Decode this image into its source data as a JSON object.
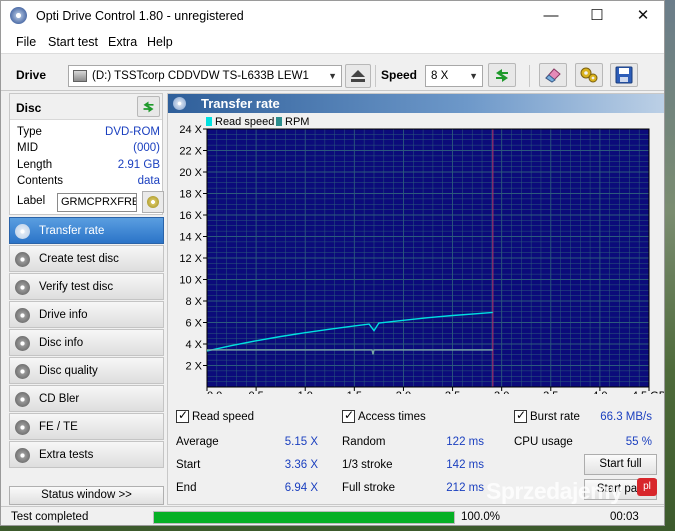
{
  "window": {
    "title": "Opti Drive Control 1.80 - unregistered",
    "minimize": "—",
    "maximize": "☐",
    "close": "✕"
  },
  "menu": [
    "File",
    "Start test",
    "Extra",
    "Help"
  ],
  "toolbar": {
    "drive_label": "Drive",
    "drive_value": "(D:)   TSSTcorp CDDVDW TS-L633B LEW1",
    "speed_label": "Speed",
    "speed_value": "8 X",
    "icons": [
      "eject-icon",
      "refresh-icon",
      "eraser-icon",
      "gears-icon",
      "save-icon"
    ]
  },
  "disc": {
    "header": "Disc",
    "rows": [
      {
        "key": "Type",
        "value": "DVD-ROM"
      },
      {
        "key": "MID",
        "value": "(000)"
      },
      {
        "key": "Length",
        "value": "2.91 GB"
      },
      {
        "key": "Contents",
        "value": "data"
      }
    ],
    "label_key": "Label",
    "label_value": "GRMCPRXFRER"
  },
  "nav": [
    {
      "label": "Transfer rate",
      "active": true
    },
    {
      "label": "Create test disc",
      "active": false
    },
    {
      "label": "Verify test disc",
      "active": false
    },
    {
      "label": "Drive info",
      "active": false
    },
    {
      "label": "Disc info",
      "active": false
    },
    {
      "label": "Disc quality",
      "active": false
    },
    {
      "label": "CD Bler",
      "active": false
    },
    {
      "label": "FE / TE",
      "active": false
    },
    {
      "label": "Extra tests",
      "active": false
    }
  ],
  "status_window_button": "Status window >>",
  "panel": {
    "title": "Transfer rate",
    "legend": [
      {
        "name": "Read speed",
        "color": "#00e0e0"
      },
      {
        "name": "RPM",
        "color": "#2a8c8c"
      }
    ]
  },
  "chart_data": {
    "type": "line",
    "x_ticks": [
      "0.0",
      "0.5",
      "1.0",
      "1.5",
      "2.0",
      "2.5",
      "3.0",
      "3.5",
      "4.0",
      "4.5 GB"
    ],
    "y_ticks": [
      "2 X",
      "4 X",
      "6 X",
      "8 X",
      "10 X",
      "12 X",
      "14 X",
      "16 X",
      "18 X",
      "20 X",
      "22 X",
      "24 X"
    ],
    "xlim": [
      0,
      4.5
    ],
    "ylim": [
      0,
      24
    ],
    "disc_end_marker": 2.91,
    "series": [
      {
        "name": "Read speed",
        "x": [
          0.0,
          0.25,
          0.5,
          0.75,
          1.0,
          1.25,
          1.5,
          1.65,
          1.7,
          1.75,
          2.0,
          2.25,
          2.5,
          2.75,
          2.91
        ],
        "y": [
          3.36,
          3.85,
          4.3,
          4.7,
          5.05,
          5.38,
          5.68,
          5.85,
          5.25,
          5.95,
          6.2,
          6.45,
          6.65,
          6.82,
          6.94
        ]
      },
      {
        "name": "RPM",
        "x": [
          0.0,
          1.68,
          1.69,
          1.7,
          2.91
        ],
        "y": [
          3.45,
          3.45,
          3.05,
          3.45,
          3.45
        ]
      }
    ],
    "grid": true,
    "background": "#0b0b7a",
    "grid_color": "#2c5a7c"
  },
  "stats": {
    "read_speed_label": "Read speed",
    "access_times_label": "Access times",
    "burst_rate_label": "Burst rate",
    "burst_rate_value": "66.3 MB/s",
    "average_label": "Average",
    "average_value": "5.15 X",
    "start_label": "Start",
    "start_value": "3.36 X",
    "end_label": "End",
    "end_value": "6.94 X",
    "random_label": "Random",
    "random_value": "122 ms",
    "one_third_label": "1/3 stroke",
    "one_third_value": "142 ms",
    "full_stroke_label": "Full stroke",
    "full_stroke_value": "212 ms",
    "cpu_label": "CPU usage",
    "cpu_value": "55 %",
    "start_full_button": "Start full",
    "start_part_button": "Start part"
  },
  "statusbar": {
    "text": "Test completed",
    "progress_fraction": 1.0,
    "percent": "100.0%",
    "time": "00:03"
  },
  "watermark": {
    "text": "Sprzedajemy",
    "badge": "pl"
  }
}
